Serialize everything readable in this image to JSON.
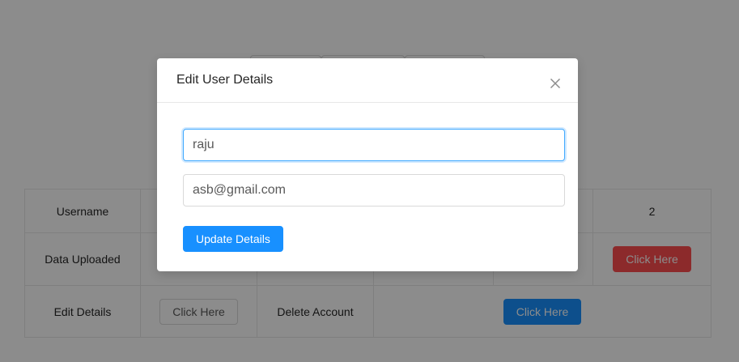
{
  "table": {
    "row1": {
      "label": "Username",
      "last_value": "2"
    },
    "row2": {
      "label": "Data Uploaded",
      "button_label": "Click Here"
    },
    "row3": {
      "label": "Edit Details",
      "edit_button_label": "Click Here",
      "delete_label": "Delete Account",
      "delete_button_label": "Click Here"
    }
  },
  "modal": {
    "title": "Edit User Details",
    "username_value": "raju",
    "email_value": "asb@gmail.com",
    "update_button_label": "Update Details",
    "close_icon": "close-icon"
  },
  "colors": {
    "primary": "#1890ff",
    "danger": "#ff4d4f",
    "mask": "rgba(0,0,0,0.45)"
  }
}
